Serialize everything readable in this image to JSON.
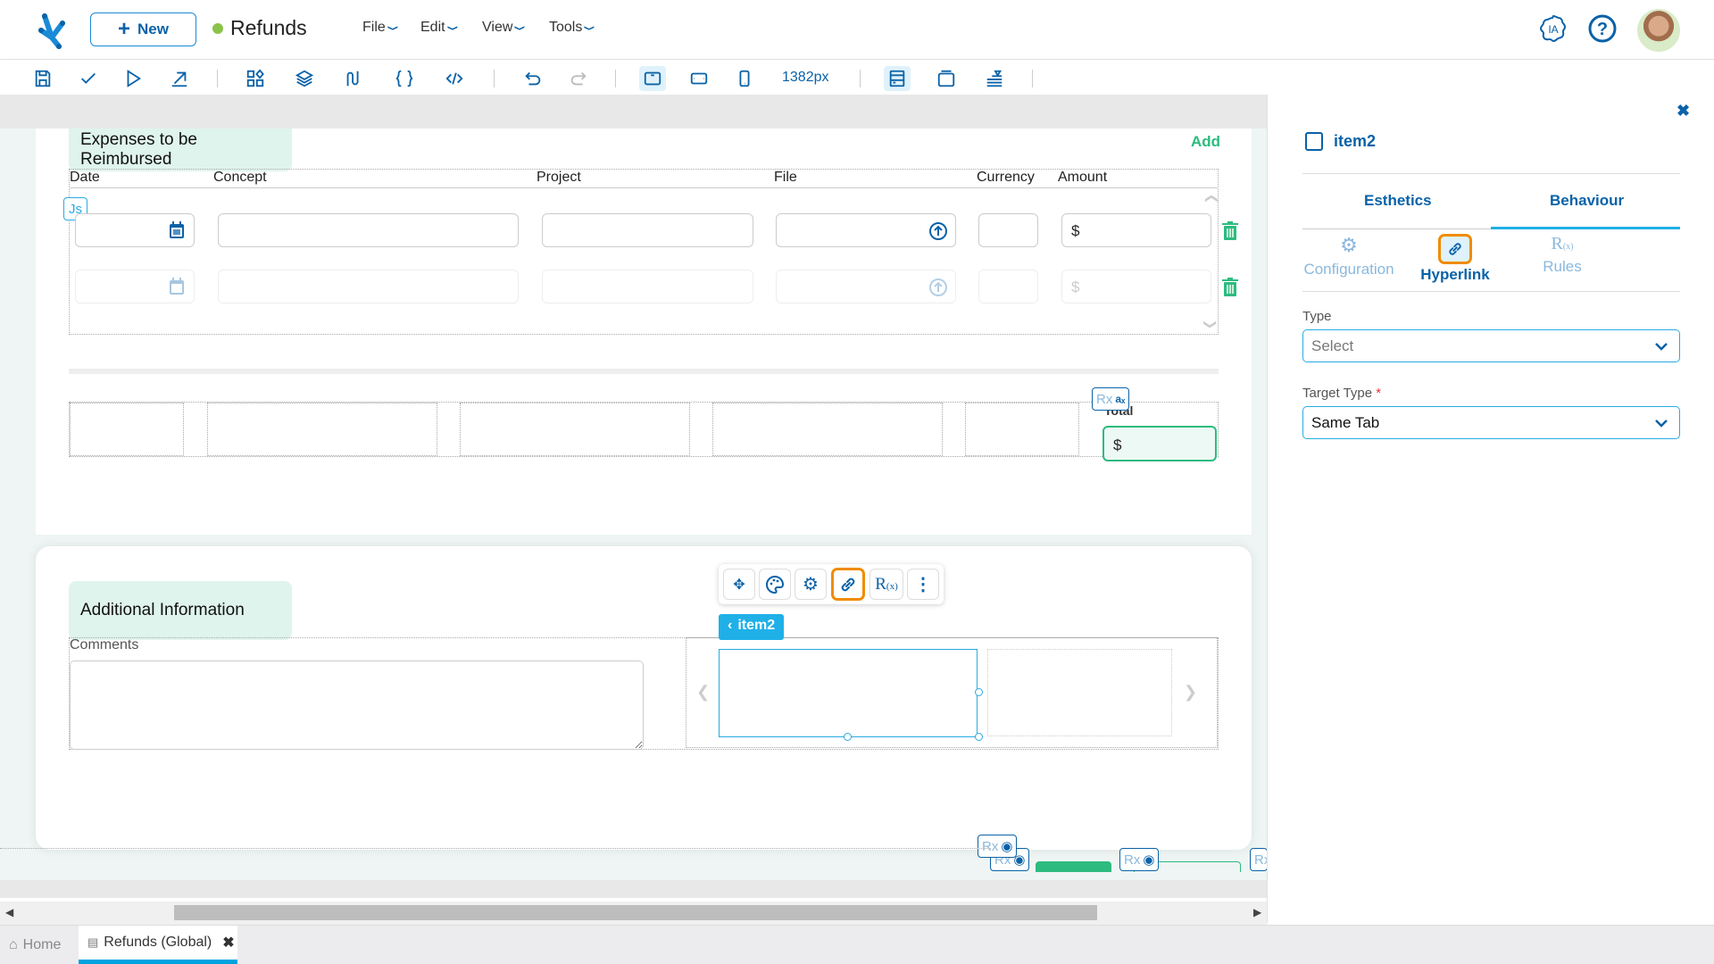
{
  "app": {
    "new_button": "New",
    "document_title": "Refunds",
    "document_status_color": "#8bc34a",
    "menus": [
      "File",
      "Edit",
      "View",
      "Tools"
    ],
    "header_icons": [
      "ia-icon",
      "help-icon",
      "user-avatar"
    ],
    "ia_label": "IA"
  },
  "toolbar": {
    "buttons": [
      "save",
      "validate",
      "run",
      "publish",
      "components",
      "layers",
      "flows",
      "json",
      "code",
      "undo",
      "redo",
      "desktop-view",
      "tablet-view",
      "mobile-view",
      "page-layout",
      "modal-layout",
      "pin-layout"
    ],
    "active_view": "desktop-view",
    "width_readout": "1382px"
  },
  "form": {
    "expenses_section": {
      "title": "Expenses to be Reimbursed",
      "add_label": "Add",
      "js_badge": "Js",
      "columns": [
        "Date",
        "Concept",
        "Project",
        "File",
        "Currency",
        "Amount"
      ],
      "rows": [
        {
          "date": "",
          "concept": "",
          "project": "",
          "file": "",
          "currency": "",
          "amount": "$"
        },
        {
          "date": "",
          "concept": "",
          "project": "",
          "file": "",
          "currency": "",
          "amount": "$"
        }
      ],
      "total_label": "Total",
      "total_value": "$",
      "rx_badge": "Rx"
    },
    "additional_section": {
      "title": "Additional Information",
      "comments_label": "Comments",
      "comments_value": "",
      "selected_item": "item2",
      "selected_breadcrumb": "item2"
    },
    "floating_toolbar": [
      "move",
      "esthetics",
      "configuration",
      "hyperlink",
      "rules",
      "more"
    ],
    "floating_toolbar_active": "hyperlink",
    "bottom_rx_badges": [
      "Rx",
      "Rx",
      "Rx",
      "Rx"
    ]
  },
  "panel": {
    "item_name": "item2",
    "tabs": [
      "Esthetics",
      "Behaviour"
    ],
    "active_tab": "Behaviour",
    "subtabs": [
      "Configuration",
      "Hyperlink",
      "Rules"
    ],
    "active_subtab": "Hyperlink",
    "fields": {
      "type_label": "Type",
      "type_value": "Select",
      "target_type_label": "Target Type",
      "target_type_required": "*",
      "target_type_value": "Same Tab"
    }
  },
  "bottom_tabs": [
    {
      "label": "Home",
      "active": false
    },
    {
      "label": "Refunds (Global)",
      "active": true
    }
  ],
  "colors": {
    "primary": "#0a62a8",
    "accent": "#29abe2",
    "green": "#2dbb7f",
    "highlight": "#f08c00",
    "section_bg": "#dff4ec"
  }
}
